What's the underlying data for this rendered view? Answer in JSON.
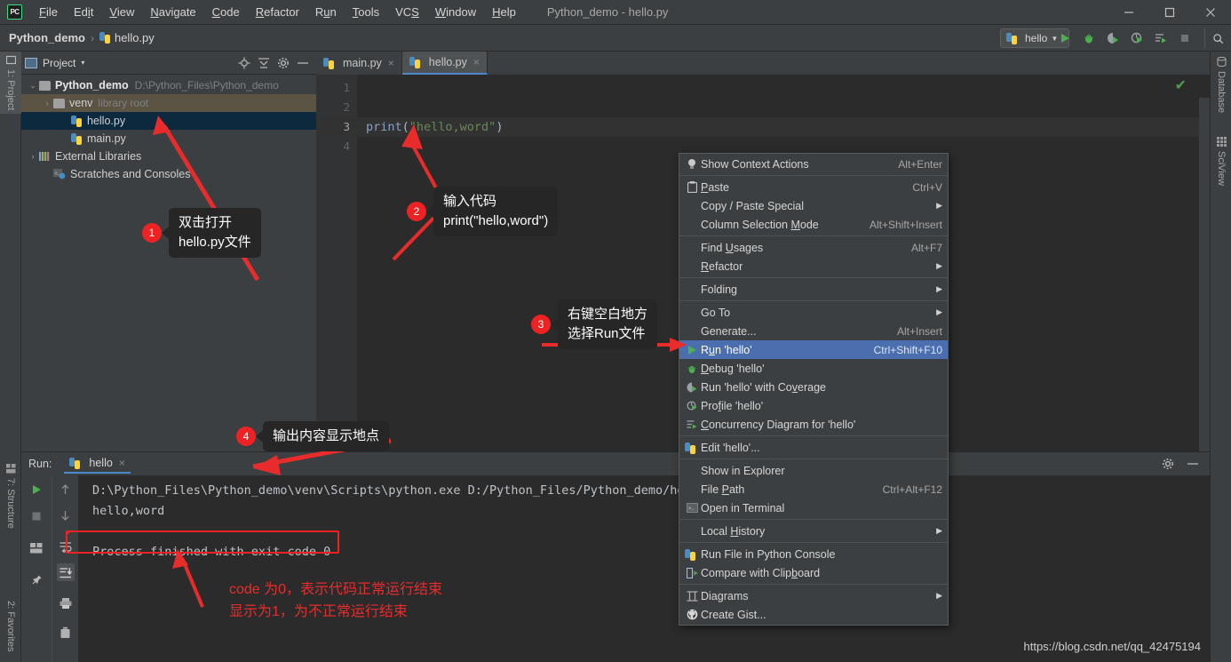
{
  "titlebar": {
    "logo": "PC",
    "window_title": "Python_demo - hello.py",
    "menu": [
      "File",
      "Edit",
      "View",
      "Navigate",
      "Code",
      "Refactor",
      "Run",
      "Tools",
      "VCS",
      "Window",
      "Help"
    ],
    "controls": [
      "minimize-icon",
      "maximize-icon",
      "close-icon"
    ]
  },
  "navbar": {
    "breadcrumb_project": "Python_demo",
    "breadcrumb_sep": "›",
    "breadcrumb_file": "hello.py",
    "run_config": "hello",
    "run_config_caret": "▼",
    "toolbar_icons": [
      "run-icon",
      "debug-icon",
      "run-with-coverage-icon",
      "profile-icon",
      "concurrency-diagram-icon",
      "stop-icon",
      "search-icon"
    ]
  },
  "left_strip": {
    "tabs": [
      {
        "label": "1: Project",
        "selected": true,
        "icon": "project-icon"
      },
      {
        "label": "7: Structure",
        "selected": false,
        "icon": "structure-icon"
      },
      {
        "label": "2: Favorites",
        "selected": false,
        "icon": "favorites-icon"
      }
    ]
  },
  "right_strip": {
    "tabs": [
      {
        "label": "Database",
        "icon": "database-icon"
      },
      {
        "label": "SciView",
        "icon": "sciview-icon"
      }
    ]
  },
  "project_panel": {
    "title": "Project",
    "caret": "▾",
    "header_icons": [
      "locate-icon",
      "collapse-all-icon",
      "gear-icon",
      "hide-icon"
    ],
    "tree": [
      {
        "depth": 0,
        "arrow": "⌄",
        "label": "Python_demo",
        "bold": true,
        "path": "D:\\Python_Files\\Python_demo",
        "icon": "folder-icon",
        "state": "none"
      },
      {
        "depth": 1,
        "arrow": "›",
        "label": "venv",
        "bold": false,
        "path": "library root",
        "icon": "folder-icon",
        "state": "tan"
      },
      {
        "depth": 2,
        "arrow": "",
        "label": "hello.py",
        "bold": false,
        "path": "",
        "icon": "python-file-icon",
        "state": "blue"
      },
      {
        "depth": 2,
        "arrow": "",
        "label": "main.py",
        "bold": false,
        "path": "",
        "icon": "python-file-icon",
        "state": "none"
      },
      {
        "depth": 0,
        "arrow": "›",
        "label": "External Libraries",
        "bold": false,
        "path": "",
        "icon": "libraries-icon",
        "state": "none"
      },
      {
        "depth": 1,
        "arrow": "",
        "label": "Scratches and Consoles",
        "bold": false,
        "path": "",
        "icon": "scratches-icon",
        "state": "none"
      }
    ]
  },
  "editor": {
    "tabs": [
      {
        "label": "main.py",
        "active": false,
        "icon": "python-file-icon",
        "close": "×"
      },
      {
        "label": "hello.py",
        "active": true,
        "icon": "python-file-icon",
        "close": "×"
      }
    ],
    "line_numbers": [
      "1",
      "2",
      "3",
      "4"
    ],
    "code": {
      "line3_fn": "print",
      "line3_open": "(",
      "line3_str": "\"hello,word\"",
      "line3_close": ")"
    },
    "inspection_status": "✔"
  },
  "context_menu": {
    "items": [
      {
        "label": "Show Context Actions",
        "key": "Alt+Enter",
        "icon": "lightbulb-icon",
        "submenu": false,
        "selected": false,
        "underline": ""
      },
      {
        "sep": true
      },
      {
        "label": "Paste",
        "key": "Ctrl+V",
        "icon": "paste-icon",
        "submenu": false,
        "selected": false,
        "underline": "P"
      },
      {
        "label": "Copy / Paste Special",
        "key": "",
        "icon": "",
        "submenu": true,
        "selected": false,
        "underline": ""
      },
      {
        "label": "Column Selection Mode",
        "key": "Alt+Shift+Insert",
        "icon": "",
        "submenu": false,
        "selected": false,
        "underline": "M"
      },
      {
        "sep": true
      },
      {
        "label": "Find Usages",
        "key": "Alt+F7",
        "icon": "",
        "submenu": false,
        "selected": false,
        "underline": "U"
      },
      {
        "label": "Refactor",
        "key": "",
        "icon": "",
        "submenu": true,
        "selected": false,
        "underline": "R"
      },
      {
        "sep": true
      },
      {
        "label": "Folding",
        "key": "",
        "icon": "",
        "submenu": true,
        "selected": false,
        "underline": ""
      },
      {
        "sep": true
      },
      {
        "label": "Go To",
        "key": "",
        "icon": "",
        "submenu": true,
        "selected": false,
        "underline": ""
      },
      {
        "label": "Generate...",
        "key": "Alt+Insert",
        "icon": "",
        "submenu": false,
        "selected": false,
        "underline": ""
      },
      {
        "label": "Run 'hello'",
        "key": "Ctrl+Shift+F10",
        "icon": "run-icon",
        "submenu": false,
        "selected": true,
        "underline": "u"
      },
      {
        "label": "Debug 'hello'",
        "key": "",
        "icon": "debug-icon",
        "submenu": false,
        "selected": false,
        "underline": "D"
      },
      {
        "label": "Run 'hello' with Coverage",
        "key": "",
        "icon": "run-with-coverage-icon",
        "submenu": false,
        "selected": false,
        "underline": "v"
      },
      {
        "label": "Profile 'hello'",
        "key": "",
        "icon": "profile-icon",
        "submenu": false,
        "selected": false,
        "underline": "f"
      },
      {
        "label": "Concurrency Diagram for 'hello'",
        "key": "",
        "icon": "concurrency-diagram-icon",
        "submenu": false,
        "selected": false,
        "underline": "C"
      },
      {
        "sep": true
      },
      {
        "label": "Edit 'hello'...",
        "key": "",
        "icon": "python-icon",
        "submenu": false,
        "selected": false,
        "underline": ""
      },
      {
        "sep": true
      },
      {
        "label": "Show in Explorer",
        "key": "",
        "icon": "",
        "submenu": false,
        "selected": false,
        "underline": ""
      },
      {
        "label": "File Path",
        "key": "Ctrl+Alt+F12",
        "icon": "",
        "submenu": false,
        "selected": false,
        "underline": "P"
      },
      {
        "label": "Open in Terminal",
        "key": "",
        "icon": "terminal-icon",
        "submenu": false,
        "selected": false,
        "underline": ""
      },
      {
        "sep": true
      },
      {
        "label": "Local History",
        "key": "",
        "icon": "",
        "submenu": true,
        "selected": false,
        "underline": "H"
      },
      {
        "sep": true
      },
      {
        "label": "Run File in Python Console",
        "key": "",
        "icon": "python-icon",
        "submenu": false,
        "selected": false,
        "underline": ""
      },
      {
        "label": "Compare with Clipboard",
        "key": "",
        "icon": "compare-icon",
        "submenu": false,
        "selected": false,
        "underline": "b"
      },
      {
        "sep": true
      },
      {
        "label": "Diagrams",
        "key": "",
        "icon": "diagrams-icon",
        "submenu": true,
        "selected": false,
        "underline": ""
      },
      {
        "label": "Create Gist...",
        "key": "",
        "icon": "github-icon",
        "submenu": false,
        "selected": false,
        "underline": ""
      }
    ]
  },
  "run_panel": {
    "label": "Run:",
    "tab": "hello",
    "tab_close": "×",
    "header_icons": [
      "gear-icon",
      "hide-icon"
    ],
    "left_tools": [
      "rerun-icon",
      "stop-icon",
      "layout-icon",
      "pin-icon"
    ],
    "side_tools": [
      "up-icon",
      "down-icon",
      "soft-wrap-icon",
      "scroll-to-end-icon",
      "print-icon",
      "trash-icon"
    ],
    "console_line1": "D:\\Python_Files\\Python_demo\\venv\\Scripts\\python.exe D:/Python_Files/Python_demo/hell",
    "console_line2": "hello,word",
    "console_line3": "",
    "console_line4": "Process finished with exit code 0"
  },
  "annotations": {
    "callouts": [
      {
        "number": "1",
        "text": "双击打开\nhello.py文件"
      },
      {
        "number": "2",
        "text": "输入代码\nprint(\"hello,word\")"
      },
      {
        "number": "3",
        "text": "右键空白地方\n选择Run文件"
      },
      {
        "number": "4",
        "text": "输出内容显示地点"
      }
    ],
    "note_red": "code 为0，表示代码正常运行结束\n显示为1，为不正常运行结束",
    "accent_color": "#ee2222"
  },
  "watermark": "https://blog.csdn.net/qq_42475194"
}
